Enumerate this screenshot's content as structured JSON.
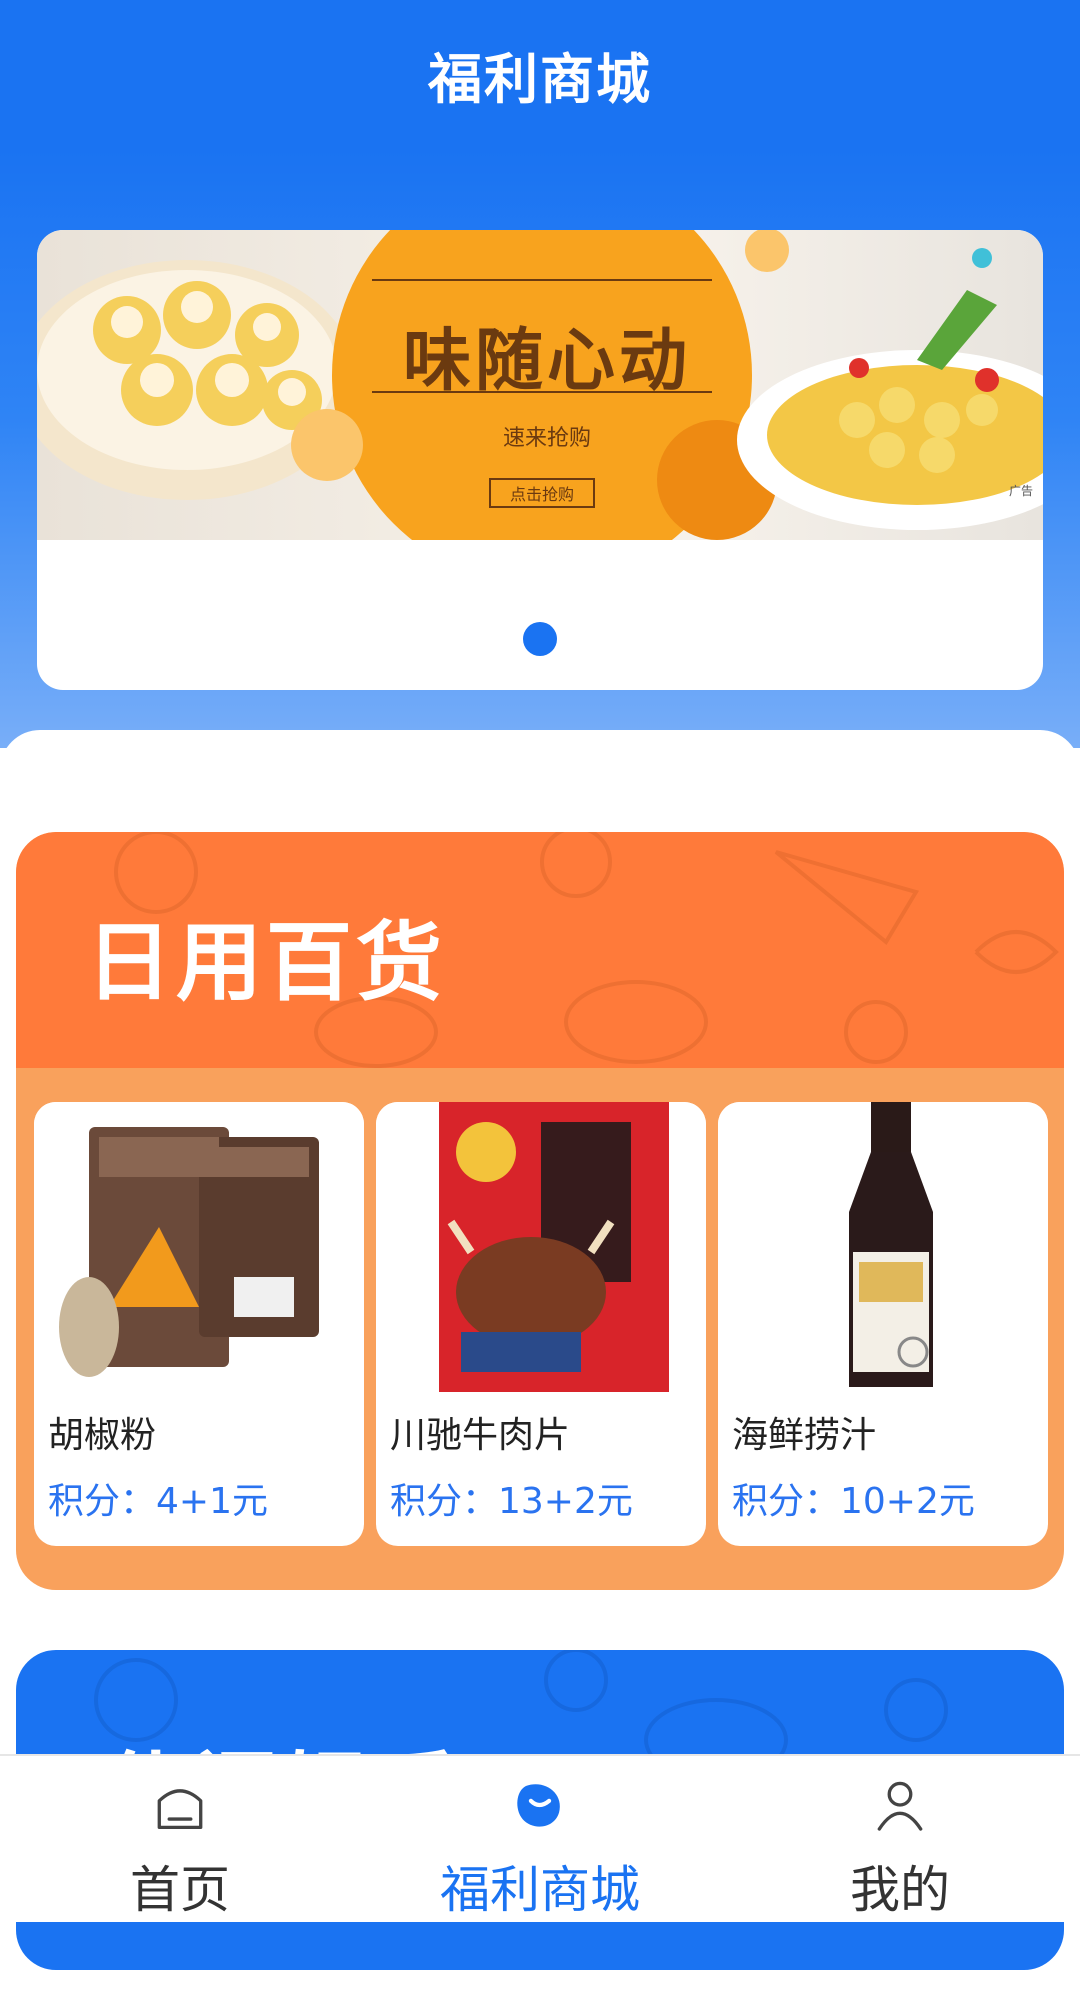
{
  "header": {
    "title": "福利商城"
  },
  "banner": {
    "headline": "味随心动",
    "subtitle": "速来抢购",
    "button": "点击抢购",
    "tag": "广告"
  },
  "section_daily": {
    "title": "日用百货",
    "products": [
      {
        "name": "胡椒粉",
        "price": "积分：4+1元"
      },
      {
        "name": "川驰牛肉片",
        "price": "积分：13+2元"
      },
      {
        "name": "海鲜捞汁",
        "price": "积分：10+2元"
      }
    ]
  },
  "section_leisure": {
    "title": "休闲娱乐"
  },
  "tabbar": {
    "items": [
      {
        "label": "首页",
        "icon": "home-icon"
      },
      {
        "label": "福利商城",
        "icon": "bean-icon"
      },
      {
        "label": "我的",
        "icon": "user-icon"
      }
    ],
    "active": 1
  },
  "colors": {
    "primary": "#1a73f2",
    "orange": "#ff7a3a",
    "orange_light": "#f9a15c"
  }
}
